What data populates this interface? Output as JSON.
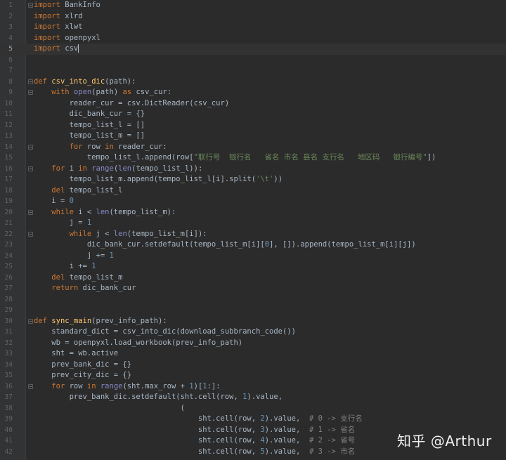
{
  "editor": {
    "current_line": 5,
    "line_numbers": [
      "1",
      "2",
      "3",
      "4",
      "5",
      "6",
      "7",
      "8",
      "9",
      "10",
      "11",
      "12",
      "13",
      "14",
      "15",
      "16",
      "17",
      "18",
      "19",
      "20",
      "21",
      "22",
      "23",
      "24",
      "25",
      "26",
      "27",
      "28",
      "29",
      "30",
      "31",
      "32",
      "33",
      "34",
      "35",
      "36",
      "37",
      "38",
      "39",
      "40",
      "41",
      "42"
    ],
    "lines": [
      "import BankInfo",
      "import xlrd",
      "import xlwt",
      "import openpyxl",
      "import csv",
      "",
      "",
      "def csv_into_dic(path):",
      "    with open(path) as csv_cur:",
      "        reader_cur = csv.DictReader(csv_cur)",
      "        dic_bank_cur = {}",
      "        tempo_list_l = []",
      "        tempo_list_m = []",
      "        for row in reader_cur:",
      "            tempo_list_l.append(row[\"联行号  银行名   省名 市名 县名 支行名   地区码   银行编号\"])",
      "    for i in range(len(tempo_list_l)):",
      "        tempo_list_m.append(tempo_list_l[i].split('\\t'))",
      "    del tempo_list_l",
      "    i = 0",
      "    while i < len(tempo_list_m):",
      "        j = 1",
      "        while j < len(tempo_list_m[i]):",
      "            dic_bank_cur.setdefault(tempo_list_m[i][0], []).append(tempo_list_m[i][j])",
      "            j += 1",
      "        i += 1",
      "    del tempo_list_m",
      "    return dic_bank_cur",
      "",
      "",
      "def sync_main(prev_info_path):",
      "    standard_dict = csv_into_dic(download_subbranch_code())",
      "    wb = openpyxl.load_workbook(prev_info_path)",
      "    sht = wb.active",
      "    prev_bank_dic = {}",
      "    prev_city_dic = {}",
      "    for row in range(sht.max_row + 1)[1:]:",
      "        prev_bank_dic.setdefault(sht.cell(row, 1).value,",
      "                                 (",
      "                                     sht.cell(row, 2).value,  # 0 -> 支行名",
      "                                     sht.cell(row, 3).value,  # 1 -> 省名",
      "                                     sht.cell(row, 4).value,  # 2 -> 省号",
      "                                     sht.cell(row, 5).value,  # 3 -> 市名"
    ]
  },
  "watermark": "知乎 @Arthur",
  "colors": {
    "background": "#2b2b2b",
    "gutter": "#313335",
    "keyword": "#cc7832",
    "function": "#ffc66d",
    "builtin": "#8888c6",
    "number": "#6897bb",
    "string": "#6a8759",
    "comment": "#808080",
    "text": "#a9b7c6"
  }
}
